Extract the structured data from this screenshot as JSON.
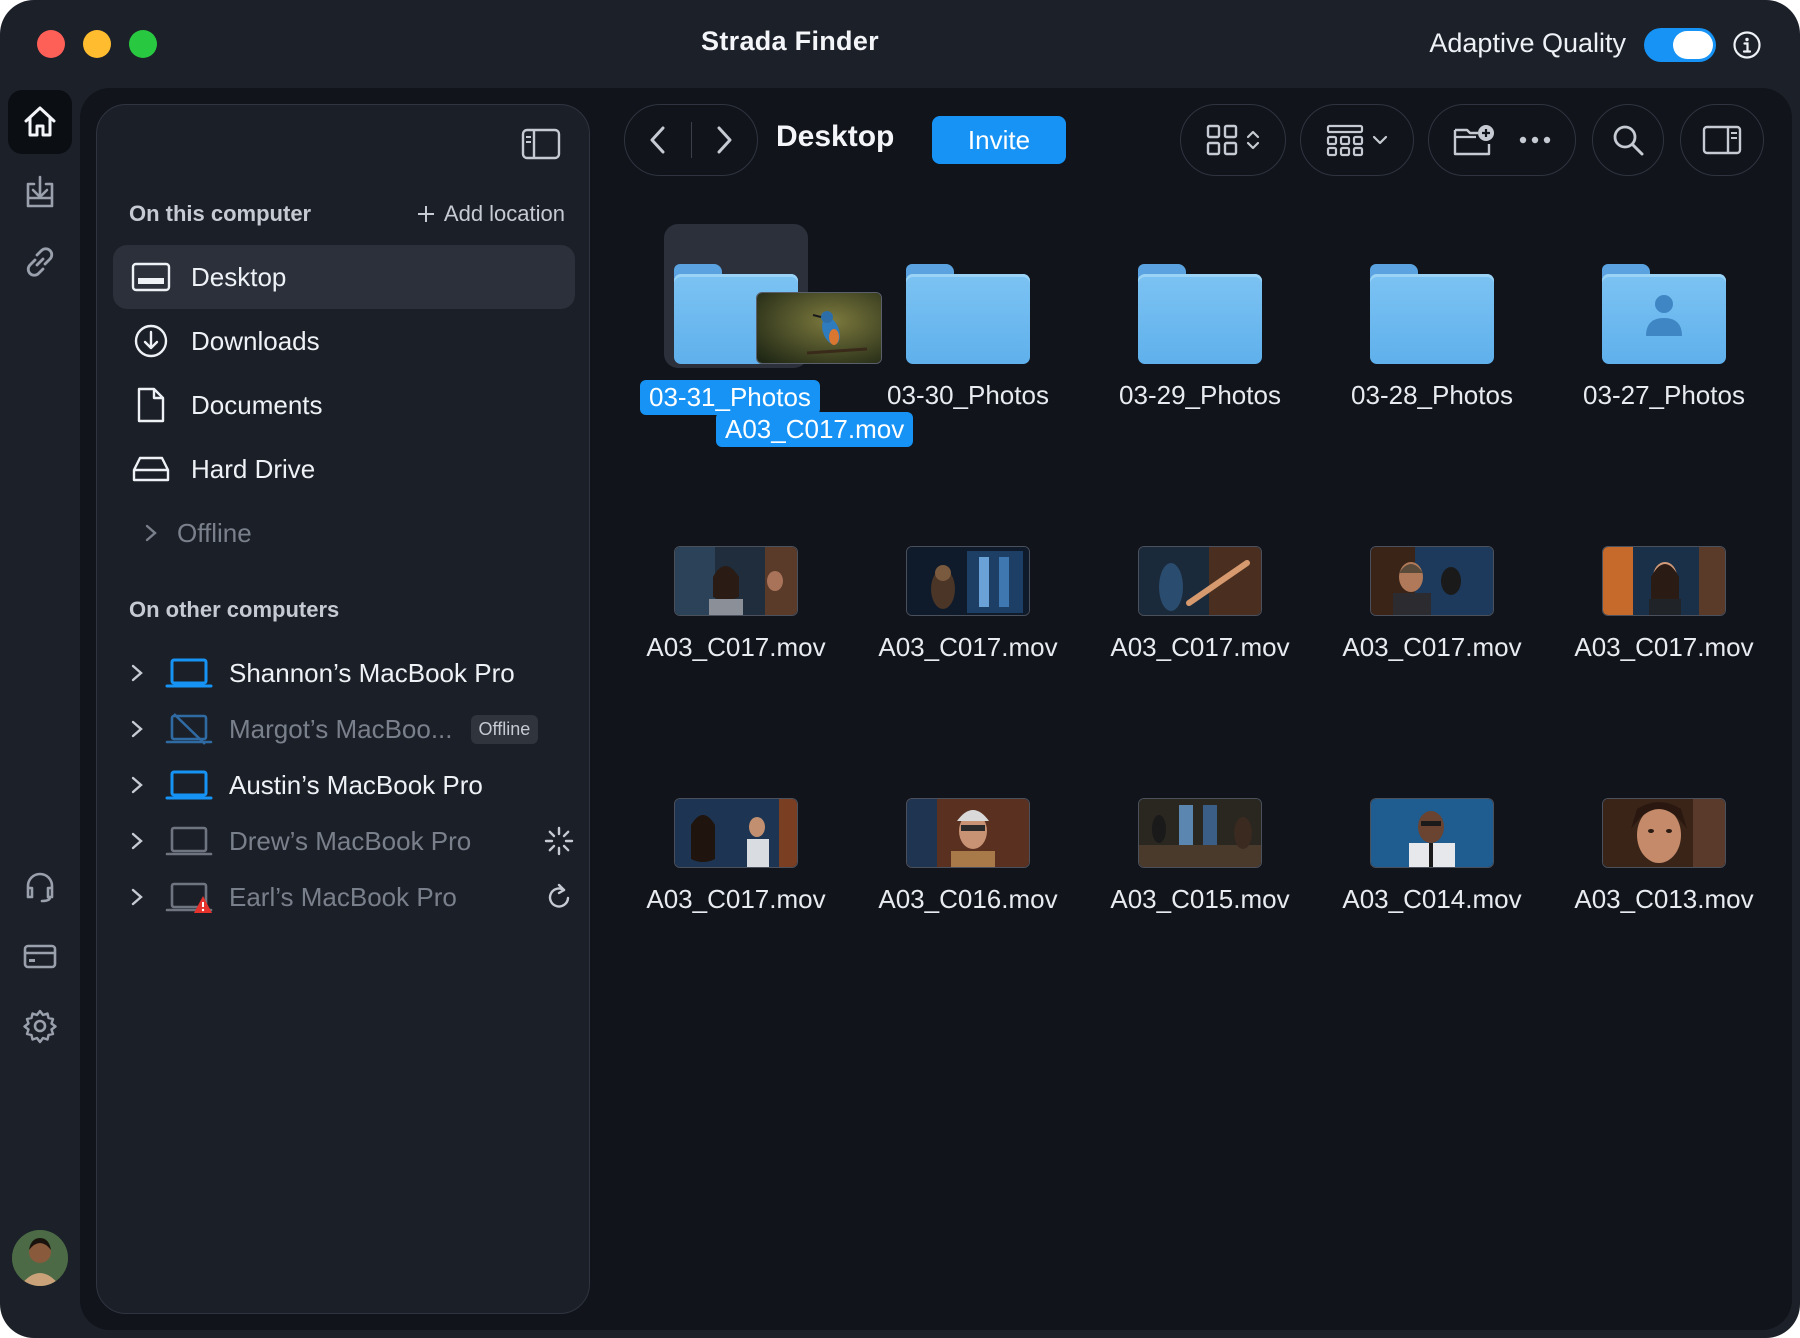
{
  "window": {
    "title": "Strada Finder"
  },
  "titlebar": {
    "adaptive_quality_label": "Adaptive Quality",
    "adaptive_quality_on": true
  },
  "rail": {
    "top": [
      "home-icon",
      "import-icon",
      "link-icon"
    ],
    "bottom": [
      "headset-icon",
      "card-icon",
      "gear-icon"
    ]
  },
  "sidebar": {
    "on_this_computer": "On this computer",
    "add_location": "Add location",
    "locations": [
      {
        "label": "Desktop",
        "icon": "desktop-icon",
        "active": true
      },
      {
        "label": "Downloads",
        "icon": "download-icon"
      },
      {
        "label": "Documents",
        "icon": "document-icon"
      },
      {
        "label": "Hard Drive",
        "icon": "harddrive-icon"
      }
    ],
    "offline_label": "Offline",
    "on_other_computers": "On other computers",
    "computers": [
      {
        "label": "Shannon’s MacBook Pro",
        "state": "online"
      },
      {
        "label": "Margot’s MacBoo...",
        "state": "offline",
        "badge": "Offline"
      },
      {
        "label": "Austin’s MacBook Pro",
        "state": "online"
      },
      {
        "label": "Drew’s MacBook Pro",
        "state": "connecting"
      },
      {
        "label": "Earl’s MacBook Pro",
        "state": "error"
      }
    ]
  },
  "toolbar": {
    "location": "Desktop",
    "invite_label": "Invite"
  },
  "grid": {
    "rows": [
      [
        {
          "name": "03-31_Photos",
          "kind": "folder",
          "selected": true
        },
        {
          "name": "03-30_Photos",
          "kind": "folder"
        },
        {
          "name": "03-29_Photos",
          "kind": "folder"
        },
        {
          "name": "03-28_Photos",
          "kind": "folder"
        },
        {
          "name": "03-27_Photos",
          "kind": "shared-folder"
        }
      ],
      [
        {
          "name": "A03_C017.mov",
          "kind": "video"
        },
        {
          "name": "A03_C017.mov",
          "kind": "video"
        },
        {
          "name": "A03_C017.mov",
          "kind": "video"
        },
        {
          "name": "A03_C017.mov",
          "kind": "video"
        },
        {
          "name": "A03_C017.mov",
          "kind": "video"
        }
      ],
      [
        {
          "name": "A03_C017.mov",
          "kind": "video"
        },
        {
          "name": "A03_C016.mov",
          "kind": "video"
        },
        {
          "name": "A03_C015.mov",
          "kind": "video"
        },
        {
          "name": "A03_C014.mov",
          "kind": "video"
        },
        {
          "name": "A03_C013.mov",
          "kind": "video"
        }
      ]
    ],
    "drag_label": "A03_C017.mov"
  },
  "colors": {
    "accent": "#1693f5",
    "window_bg": "#1c2029",
    "panel_bg": "#11141a",
    "sidebar_bg": "#1b1f27",
    "folder": "#6bb8ef"
  }
}
